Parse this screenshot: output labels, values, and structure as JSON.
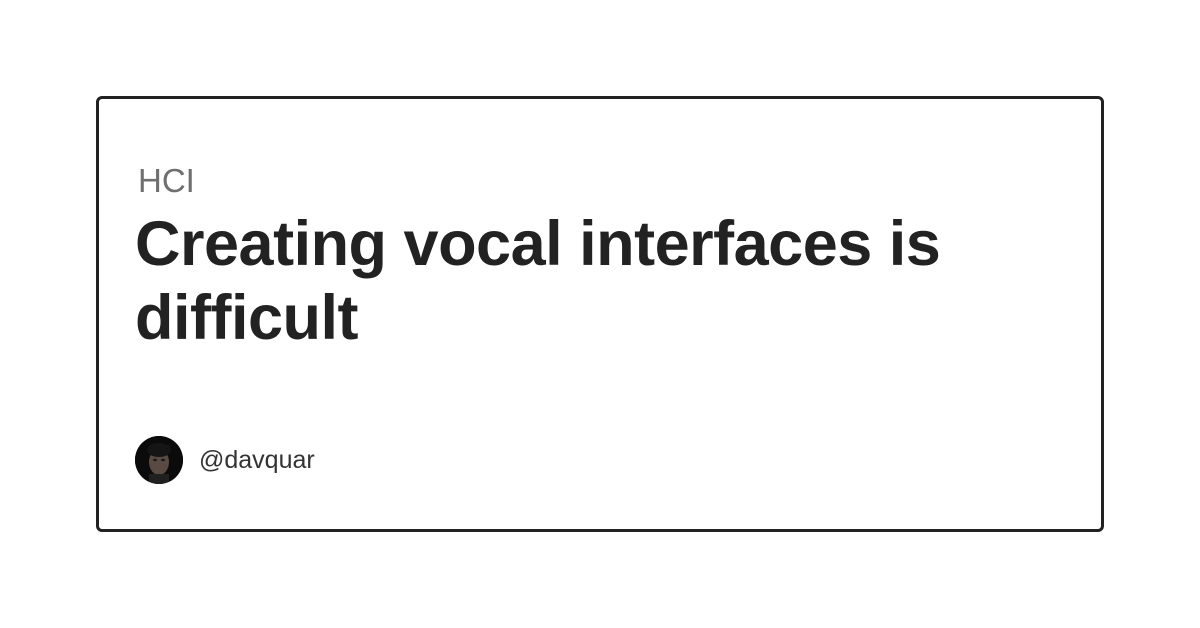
{
  "card": {
    "category": "HCI",
    "title": "Creating vocal interfaces is difficult",
    "author": {
      "handle": "@davquar",
      "avatar_icon": "user-photo-avatar"
    }
  },
  "colors": {
    "border": "#222222",
    "title": "#222222",
    "category": "#6f6f6f",
    "background": "#ffffff"
  }
}
